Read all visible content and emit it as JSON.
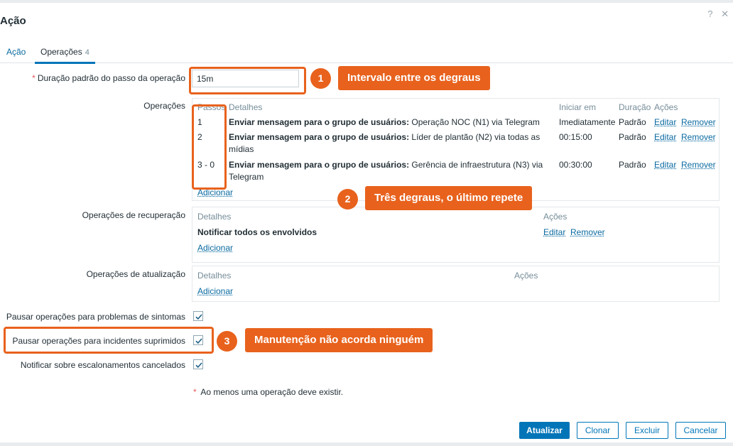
{
  "dialog": {
    "title": "Ação",
    "help_icon": "?",
    "close_icon": "✕"
  },
  "tabs": [
    {
      "label": "Ação"
    },
    {
      "label": "Operações",
      "count": "4"
    }
  ],
  "form": {
    "step_duration_label": "Duração padrão do passo da operação",
    "step_duration_value": "15m",
    "operations_label": "Operações",
    "recovery_label": "Operações de recuperação",
    "update_label": "Operações de atualização",
    "pause_symptoms_label": "Pausar operações para problemas de sintomas",
    "pause_suppressed_label": "Pausar operações para incidentes suprimidos",
    "notify_cancelled_label": "Notificar sobre escalonamentos cancelados",
    "required_note": "Ao menos uma operação deve existir.",
    "required_star": "*"
  },
  "operations_table": {
    "headers": {
      "steps": "Passos",
      "details": "Detalhes",
      "start_in": "Iniciar em",
      "duration": "Duração",
      "actions": "Ações"
    },
    "rows": [
      {
        "step": "1",
        "details_bold": "Enviar mensagem para o grupo de usuários:",
        "details_line1": "Operação NOC (N1) via Telegram",
        "details_line2": "",
        "start_in": "Imediatamente",
        "duration": "Padrão",
        "edit": "Editar",
        "remove": "Remover"
      },
      {
        "step": "2",
        "details_bold": "Enviar mensagem para o grupo de usuários:",
        "details_line1": "Líder de plantão (N2) via todas as",
        "details_line2": "mídias",
        "start_in": "00:15:00",
        "duration": "Padrão",
        "edit": "Editar",
        "remove": "Remover"
      },
      {
        "step": "3 - 0",
        "details_bold": "Enviar mensagem para o grupo de usuários:",
        "details_line1": "Gerência de infraestrutura (N3) via",
        "details_line2": "Telegram",
        "start_in": "00:30:00",
        "duration": "Padrão",
        "edit": "Editar",
        "remove": "Remover"
      }
    ],
    "add_link": "Adicionar"
  },
  "recovery_table": {
    "headers": {
      "details": "Detalhes",
      "actions": "Ações"
    },
    "row": {
      "details": "Notificar todos os envolvidos",
      "edit": "Editar",
      "remove": "Remover"
    },
    "add_link": "Adicionar"
  },
  "update_table": {
    "headers": {
      "details": "Detalhes",
      "actions": "Ações"
    },
    "add_link": "Adicionar"
  },
  "checkboxes": {
    "pause_symptoms": true,
    "pause_suppressed": true,
    "notify_cancelled": true
  },
  "annotations": [
    {
      "number": "1",
      "text": "Intervalo entre os degraus"
    },
    {
      "number": "2",
      "text": "Três degraus, o último repete"
    },
    {
      "number": "3",
      "text": "Manutenção não acorda ninguém"
    }
  ],
  "buttons": {
    "update": "Atualizar",
    "clone": "Clonar",
    "delete": "Excluir",
    "cancel": "Cancelar"
  },
  "colors": {
    "accent": "#0275b8",
    "annotation": "#e8621d",
    "required": "#e45959"
  }
}
